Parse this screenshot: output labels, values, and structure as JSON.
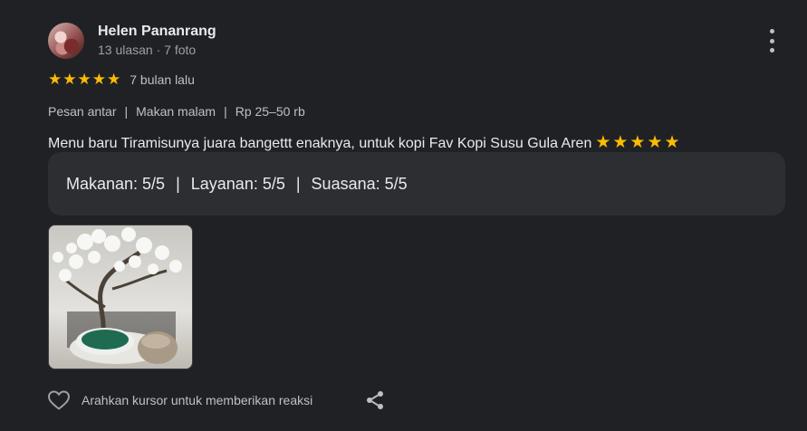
{
  "reviewer": {
    "name": "Helen Pananrang",
    "meta": "13 ulasan · 7 foto"
  },
  "rating": {
    "stars": 5,
    "star_glyph": "★",
    "time_ago": "7 bulan lalu",
    "star_color": "#fbbc04"
  },
  "tags": {
    "service": "Pesan antar",
    "meal": "Makan malam",
    "price": "Rp 25–50 rb",
    "separator": "|"
  },
  "review": {
    "text": "Menu baru Tiramisunya juara bangettt enaknya, untuk kopi Fav Kopi Susu Gula Aren",
    "emoji_stars": "★★★★★"
  },
  "scores": {
    "food": "Makanan: 5/5",
    "service": "Layanan: 5/5",
    "atmosphere": "Suasana: 5/5",
    "separator": "|"
  },
  "actions": {
    "reaction_label": "Arahkan kursor untuk memberikan reaksi",
    "heart_icon": "heart-icon",
    "share_icon": "share-icon",
    "more_icon": "more-vert-icon"
  },
  "colors": {
    "background": "#202124",
    "card": "#2d2e31",
    "text_primary": "#e8eaed",
    "text_secondary": "#9aa0a6"
  }
}
